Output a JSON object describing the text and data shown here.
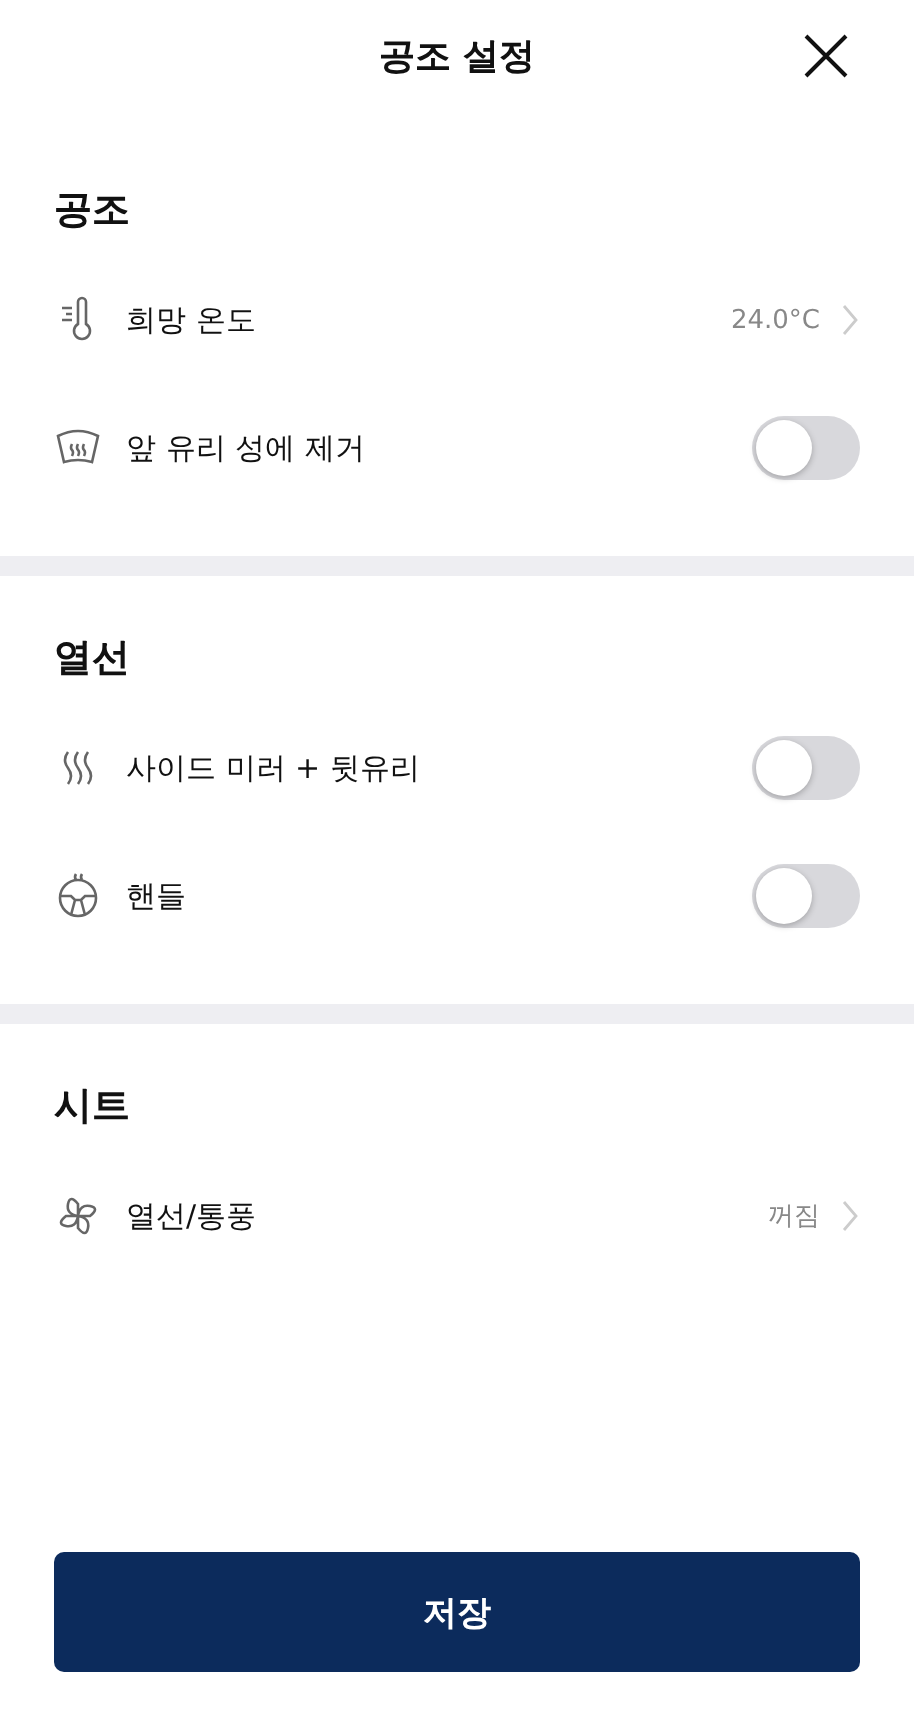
{
  "header": {
    "title": "공조 설정"
  },
  "sections": [
    {
      "title": "공조",
      "rows": [
        {
          "kind": "value",
          "label": "희망 온도",
          "value": "24.0°C"
        },
        {
          "kind": "toggle",
          "label": "앞 유리 성에 제거",
          "on": false
        }
      ]
    },
    {
      "title": "열선",
      "rows": [
        {
          "kind": "toggle",
          "label": "사이드 미러 + 뒷유리",
          "on": false
        },
        {
          "kind": "toggle",
          "label": "핸들",
          "on": false
        }
      ]
    },
    {
      "title": "시트",
      "rows": [
        {
          "kind": "value",
          "label": "열선/통풍",
          "value": "꺼짐"
        }
      ]
    }
  ],
  "save_button": "저장"
}
